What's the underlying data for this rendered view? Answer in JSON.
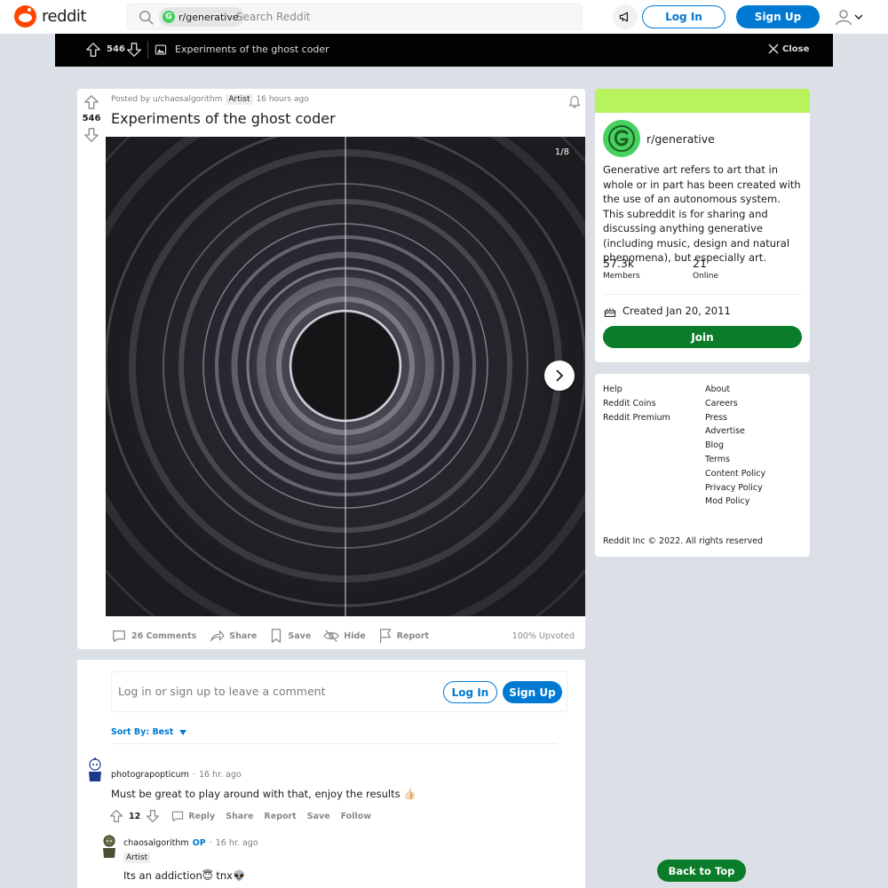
{
  "header": {
    "logo_text": "reddit",
    "search_chip": "r/generative",
    "search_placeholder": "Search Reddit",
    "login_label": "Log In",
    "signup_label": "Sign Up"
  },
  "dark_bar": {
    "vote_count": "546",
    "title": "Experiments of the ghost coder",
    "close_label": "Close"
  },
  "post": {
    "posted_by": "Posted by u/chaosalgorithm",
    "flair": "Artist",
    "time": "16 hours ago",
    "vote_count": "546",
    "title": "Experiments of the ghost coder",
    "image_counter": "1/8",
    "actions": {
      "comments": "26 Comments",
      "share": "Share",
      "save": "Save",
      "hide": "Hide",
      "report": "Report"
    },
    "upvoted": "100% Upvoted"
  },
  "comments": {
    "login_prompt": "Log in or sign up to leave a comment",
    "login_label": "Log In",
    "signup_label": "Sign Up",
    "sort_label": "Sort By: Best",
    "items": [
      {
        "author": "photograpopticum",
        "time": "16 hr. ago",
        "body": "Must be great to play around with that, enjoy the results 👍🏻",
        "votes": "12",
        "reply": "Reply",
        "share": "Share",
        "report": "Report",
        "save": "Save",
        "follow": "Follow"
      },
      {
        "author": "chaosalgorithm",
        "op": "OP",
        "time": "16 hr. ago",
        "flair": "Artist",
        "body": "Its an addiction😇 tnx👽"
      }
    ]
  },
  "sidebar": {
    "sub_name": "r/generative",
    "description": "Generative art refers to art that in whole or in part has been created with the use of an autonomous system. This subreddit is for sharing and discussing anything generative (including music, design and natural phenomena), but especially art.",
    "members_value": "57.3k",
    "members_label": "Members",
    "online_value": "21",
    "online_label": "Online",
    "created": "Created Jan 20, 2011",
    "join_label": "Join",
    "banner_color": "#b8f25c",
    "accent_color": "#0a7c2a"
  },
  "footer_links": {
    "left": [
      "Help",
      "Reddit Coins",
      "Reddit Premium"
    ],
    "right": [
      "About",
      "Careers",
      "Press",
      "Advertise",
      "Blog",
      "Terms",
      "Content Policy",
      "Privacy Policy",
      "Mod Policy"
    ],
    "copyright": "Reddit Inc © 2022. All rights reserved"
  },
  "back_to_top": "Back to Top"
}
